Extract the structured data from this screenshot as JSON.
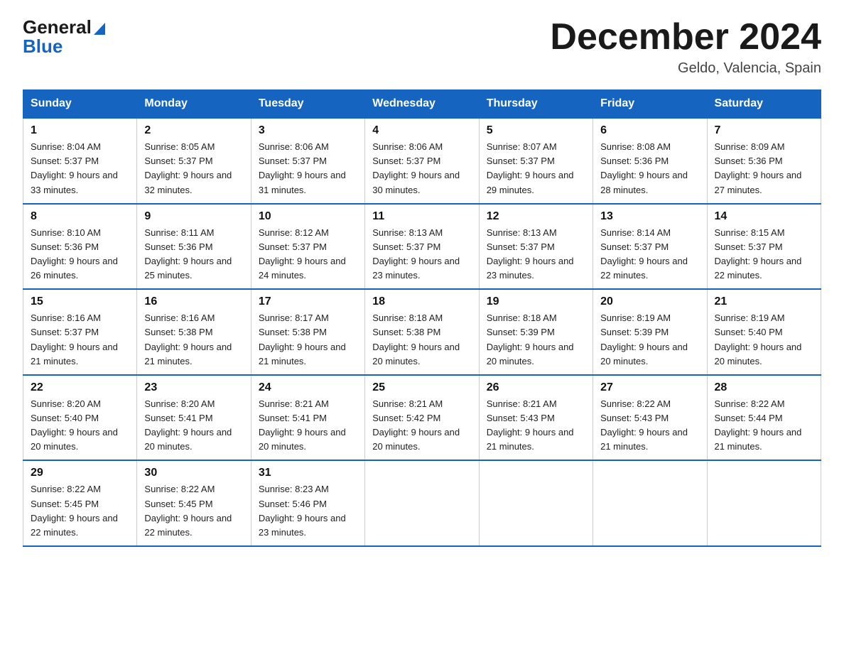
{
  "header": {
    "logo_general": "General",
    "logo_blue": "Blue",
    "title": "December 2024",
    "location": "Geldo, Valencia, Spain"
  },
  "days_of_week": [
    "Sunday",
    "Monday",
    "Tuesday",
    "Wednesday",
    "Thursday",
    "Friday",
    "Saturday"
  ],
  "weeks": [
    [
      {
        "day": "1",
        "sunrise": "8:04 AM",
        "sunset": "5:37 PM",
        "daylight": "9 hours and 33 minutes."
      },
      {
        "day": "2",
        "sunrise": "8:05 AM",
        "sunset": "5:37 PM",
        "daylight": "9 hours and 32 minutes."
      },
      {
        "day": "3",
        "sunrise": "8:06 AM",
        "sunset": "5:37 PM",
        "daylight": "9 hours and 31 minutes."
      },
      {
        "day": "4",
        "sunrise": "8:06 AM",
        "sunset": "5:37 PM",
        "daylight": "9 hours and 30 minutes."
      },
      {
        "day": "5",
        "sunrise": "8:07 AM",
        "sunset": "5:37 PM",
        "daylight": "9 hours and 29 minutes."
      },
      {
        "day": "6",
        "sunrise": "8:08 AM",
        "sunset": "5:36 PM",
        "daylight": "9 hours and 28 minutes."
      },
      {
        "day": "7",
        "sunrise": "8:09 AM",
        "sunset": "5:36 PM",
        "daylight": "9 hours and 27 minutes."
      }
    ],
    [
      {
        "day": "8",
        "sunrise": "8:10 AM",
        "sunset": "5:36 PM",
        "daylight": "9 hours and 26 minutes."
      },
      {
        "day": "9",
        "sunrise": "8:11 AM",
        "sunset": "5:36 PM",
        "daylight": "9 hours and 25 minutes."
      },
      {
        "day": "10",
        "sunrise": "8:12 AM",
        "sunset": "5:37 PM",
        "daylight": "9 hours and 24 minutes."
      },
      {
        "day": "11",
        "sunrise": "8:13 AM",
        "sunset": "5:37 PM",
        "daylight": "9 hours and 23 minutes."
      },
      {
        "day": "12",
        "sunrise": "8:13 AM",
        "sunset": "5:37 PM",
        "daylight": "9 hours and 23 minutes."
      },
      {
        "day": "13",
        "sunrise": "8:14 AM",
        "sunset": "5:37 PM",
        "daylight": "9 hours and 22 minutes."
      },
      {
        "day": "14",
        "sunrise": "8:15 AM",
        "sunset": "5:37 PM",
        "daylight": "9 hours and 22 minutes."
      }
    ],
    [
      {
        "day": "15",
        "sunrise": "8:16 AM",
        "sunset": "5:37 PM",
        "daylight": "9 hours and 21 minutes."
      },
      {
        "day": "16",
        "sunrise": "8:16 AM",
        "sunset": "5:38 PM",
        "daylight": "9 hours and 21 minutes."
      },
      {
        "day": "17",
        "sunrise": "8:17 AM",
        "sunset": "5:38 PM",
        "daylight": "9 hours and 21 minutes."
      },
      {
        "day": "18",
        "sunrise": "8:18 AM",
        "sunset": "5:38 PM",
        "daylight": "9 hours and 20 minutes."
      },
      {
        "day": "19",
        "sunrise": "8:18 AM",
        "sunset": "5:39 PM",
        "daylight": "9 hours and 20 minutes."
      },
      {
        "day": "20",
        "sunrise": "8:19 AM",
        "sunset": "5:39 PM",
        "daylight": "9 hours and 20 minutes."
      },
      {
        "day": "21",
        "sunrise": "8:19 AM",
        "sunset": "5:40 PM",
        "daylight": "9 hours and 20 minutes."
      }
    ],
    [
      {
        "day": "22",
        "sunrise": "8:20 AM",
        "sunset": "5:40 PM",
        "daylight": "9 hours and 20 minutes."
      },
      {
        "day": "23",
        "sunrise": "8:20 AM",
        "sunset": "5:41 PM",
        "daylight": "9 hours and 20 minutes."
      },
      {
        "day": "24",
        "sunrise": "8:21 AM",
        "sunset": "5:41 PM",
        "daylight": "9 hours and 20 minutes."
      },
      {
        "day": "25",
        "sunrise": "8:21 AM",
        "sunset": "5:42 PM",
        "daylight": "9 hours and 20 minutes."
      },
      {
        "day": "26",
        "sunrise": "8:21 AM",
        "sunset": "5:43 PM",
        "daylight": "9 hours and 21 minutes."
      },
      {
        "day": "27",
        "sunrise": "8:22 AM",
        "sunset": "5:43 PM",
        "daylight": "9 hours and 21 minutes."
      },
      {
        "day": "28",
        "sunrise": "8:22 AM",
        "sunset": "5:44 PM",
        "daylight": "9 hours and 21 minutes."
      }
    ],
    [
      {
        "day": "29",
        "sunrise": "8:22 AM",
        "sunset": "5:45 PM",
        "daylight": "9 hours and 22 minutes."
      },
      {
        "day": "30",
        "sunrise": "8:22 AM",
        "sunset": "5:45 PM",
        "daylight": "9 hours and 22 minutes."
      },
      {
        "day": "31",
        "sunrise": "8:23 AM",
        "sunset": "5:46 PM",
        "daylight": "9 hours and 23 minutes."
      },
      null,
      null,
      null,
      null
    ]
  ]
}
